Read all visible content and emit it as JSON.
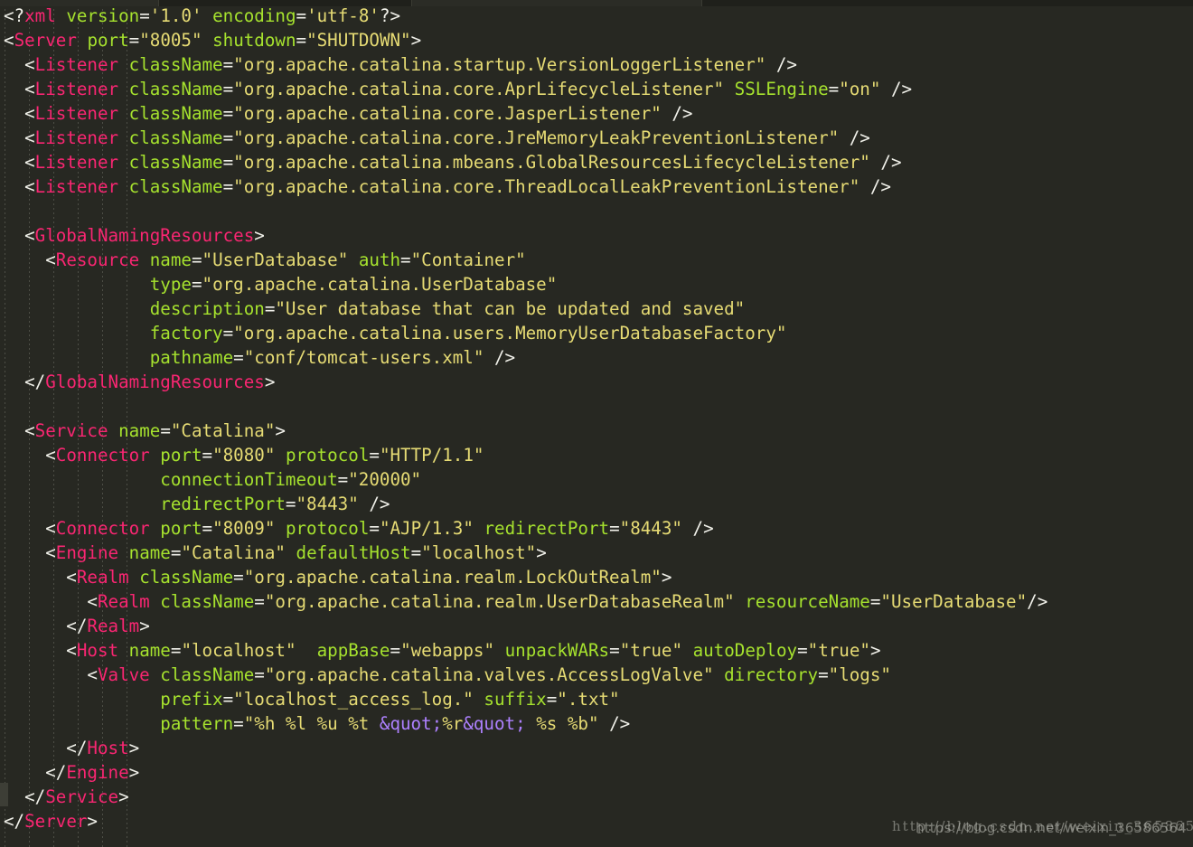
{
  "app": {
    "kind": "code-editor",
    "language": "xml",
    "theme": "monokai-dark",
    "file_description": "Apache Tomcat server.xml configuration"
  },
  "theme_colors": {
    "background": "#272822",
    "punctuation": "#f1f1ea",
    "tag_name": "#f92672",
    "attribute_name": "#a6e22e",
    "attribute_value": "#e6db74",
    "entity": "#ae81ff",
    "indent_guide": "#5a5b52",
    "top_strip": "#1f201b"
  },
  "watermarks": {
    "line1": "http://blog.csdn.net/weixin_36586564",
    "line2": "https://blog.csdn.net/weixin_36586564"
  },
  "code": {
    "lines": [
      [
        {
          "t": "punct",
          "s": "<?"
        },
        {
          "t": "tag",
          "s": "xml"
        },
        {
          "t": "punct",
          "s": " "
        },
        {
          "t": "attr",
          "s": "version"
        },
        {
          "t": "punct",
          "s": "="
        },
        {
          "t": "val",
          "s": "'1.0'"
        },
        {
          "t": "punct",
          "s": " "
        },
        {
          "t": "attr",
          "s": "encoding"
        },
        {
          "t": "punct",
          "s": "="
        },
        {
          "t": "val",
          "s": "'utf-8'"
        },
        {
          "t": "punct",
          "s": "?>"
        }
      ],
      [
        {
          "t": "punct",
          "s": "<"
        },
        {
          "t": "tag",
          "s": "Server"
        },
        {
          "t": "punct",
          "s": " "
        },
        {
          "t": "attr",
          "s": "port"
        },
        {
          "t": "punct",
          "s": "="
        },
        {
          "t": "val",
          "s": "\"8005\""
        },
        {
          "t": "punct",
          "s": " "
        },
        {
          "t": "attr",
          "s": "shutdown"
        },
        {
          "t": "punct",
          "s": "="
        },
        {
          "t": "val",
          "s": "\"SHUTDOWN\""
        },
        {
          "t": "punct",
          "s": ">"
        }
      ],
      [
        {
          "t": "punct",
          "s": "  <"
        },
        {
          "t": "tag",
          "s": "Listener"
        },
        {
          "t": "punct",
          "s": " "
        },
        {
          "t": "attr",
          "s": "className"
        },
        {
          "t": "punct",
          "s": "="
        },
        {
          "t": "val",
          "s": "\"org.apache.catalina.startup.VersionLoggerListener\""
        },
        {
          "t": "punct",
          "s": " />"
        }
      ],
      [
        {
          "t": "punct",
          "s": "  <"
        },
        {
          "t": "tag",
          "s": "Listener"
        },
        {
          "t": "punct",
          "s": " "
        },
        {
          "t": "attr",
          "s": "className"
        },
        {
          "t": "punct",
          "s": "="
        },
        {
          "t": "val",
          "s": "\"org.apache.catalina.core.AprLifecycleListener\""
        },
        {
          "t": "punct",
          "s": " "
        },
        {
          "t": "attr",
          "s": "SSLEngine"
        },
        {
          "t": "punct",
          "s": "="
        },
        {
          "t": "val",
          "s": "\"on\""
        },
        {
          "t": "punct",
          "s": " />"
        }
      ],
      [
        {
          "t": "punct",
          "s": "  <"
        },
        {
          "t": "tag",
          "s": "Listener"
        },
        {
          "t": "punct",
          "s": " "
        },
        {
          "t": "attr",
          "s": "className"
        },
        {
          "t": "punct",
          "s": "="
        },
        {
          "t": "val",
          "s": "\"org.apache.catalina.core.JasperListener\""
        },
        {
          "t": "punct",
          "s": " />"
        }
      ],
      [
        {
          "t": "punct",
          "s": "  <"
        },
        {
          "t": "tag",
          "s": "Listener"
        },
        {
          "t": "punct",
          "s": " "
        },
        {
          "t": "attr",
          "s": "className"
        },
        {
          "t": "punct",
          "s": "="
        },
        {
          "t": "val",
          "s": "\"org.apache.catalina.core.JreMemoryLeakPreventionListener\""
        },
        {
          "t": "punct",
          "s": " />"
        }
      ],
      [
        {
          "t": "punct",
          "s": "  <"
        },
        {
          "t": "tag",
          "s": "Listener"
        },
        {
          "t": "punct",
          "s": " "
        },
        {
          "t": "attr",
          "s": "className"
        },
        {
          "t": "punct",
          "s": "="
        },
        {
          "t": "val",
          "s": "\"org.apache.catalina.mbeans.GlobalResourcesLifecycleListener\""
        },
        {
          "t": "punct",
          "s": " />"
        }
      ],
      [
        {
          "t": "punct",
          "s": "  <"
        },
        {
          "t": "tag",
          "s": "Listener"
        },
        {
          "t": "punct",
          "s": " "
        },
        {
          "t": "attr",
          "s": "className"
        },
        {
          "t": "punct",
          "s": "="
        },
        {
          "t": "val",
          "s": "\"org.apache.catalina.core.ThreadLocalLeakPreventionListener\""
        },
        {
          "t": "punct",
          "s": " />"
        }
      ],
      [],
      [
        {
          "t": "punct",
          "s": "  <"
        },
        {
          "t": "tag",
          "s": "GlobalNamingResources"
        },
        {
          "t": "punct",
          "s": ">"
        }
      ],
      [
        {
          "t": "punct",
          "s": "    <"
        },
        {
          "t": "tag",
          "s": "Resource"
        },
        {
          "t": "punct",
          "s": " "
        },
        {
          "t": "attr",
          "s": "name"
        },
        {
          "t": "punct",
          "s": "="
        },
        {
          "t": "val",
          "s": "\"UserDatabase\""
        },
        {
          "t": "punct",
          "s": " "
        },
        {
          "t": "attr",
          "s": "auth"
        },
        {
          "t": "punct",
          "s": "="
        },
        {
          "t": "val",
          "s": "\"Container\""
        }
      ],
      [
        {
          "t": "punct",
          "s": "              "
        },
        {
          "t": "attr",
          "s": "type"
        },
        {
          "t": "punct",
          "s": "="
        },
        {
          "t": "val",
          "s": "\"org.apache.catalina.UserDatabase\""
        }
      ],
      [
        {
          "t": "punct",
          "s": "              "
        },
        {
          "t": "attr",
          "s": "description"
        },
        {
          "t": "punct",
          "s": "="
        },
        {
          "t": "val",
          "s": "\"User database that can be updated and saved\""
        }
      ],
      [
        {
          "t": "punct",
          "s": "              "
        },
        {
          "t": "attr",
          "s": "factory"
        },
        {
          "t": "punct",
          "s": "="
        },
        {
          "t": "val",
          "s": "\"org.apache.catalina.users.MemoryUserDatabaseFactory\""
        }
      ],
      [
        {
          "t": "punct",
          "s": "              "
        },
        {
          "t": "attr",
          "s": "pathname"
        },
        {
          "t": "punct",
          "s": "="
        },
        {
          "t": "val",
          "s": "\"conf/tomcat-users.xml\""
        },
        {
          "t": "punct",
          "s": " />"
        }
      ],
      [
        {
          "t": "punct",
          "s": "  </"
        },
        {
          "t": "tag",
          "s": "GlobalNamingResources"
        },
        {
          "t": "punct",
          "s": ">"
        }
      ],
      [],
      [
        {
          "t": "punct",
          "s": "  <"
        },
        {
          "t": "tag",
          "s": "Service"
        },
        {
          "t": "punct",
          "s": " "
        },
        {
          "t": "attr",
          "s": "name"
        },
        {
          "t": "punct",
          "s": "="
        },
        {
          "t": "val",
          "s": "\"Catalina\""
        },
        {
          "t": "punct",
          "s": ">"
        }
      ],
      [
        {
          "t": "punct",
          "s": "    <"
        },
        {
          "t": "tag",
          "s": "Connector"
        },
        {
          "t": "punct",
          "s": " "
        },
        {
          "t": "attr",
          "s": "port"
        },
        {
          "t": "punct",
          "s": "="
        },
        {
          "t": "val",
          "s": "\"8080\""
        },
        {
          "t": "punct",
          "s": " "
        },
        {
          "t": "attr",
          "s": "protocol"
        },
        {
          "t": "punct",
          "s": "="
        },
        {
          "t": "val",
          "s": "\"HTTP/1.1\""
        }
      ],
      [
        {
          "t": "punct",
          "s": "               "
        },
        {
          "t": "attr",
          "s": "connectionTimeout"
        },
        {
          "t": "punct",
          "s": "="
        },
        {
          "t": "val",
          "s": "\"20000\""
        }
      ],
      [
        {
          "t": "punct",
          "s": "               "
        },
        {
          "t": "attr",
          "s": "redirectPort"
        },
        {
          "t": "punct",
          "s": "="
        },
        {
          "t": "val",
          "s": "\"8443\""
        },
        {
          "t": "punct",
          "s": " />"
        }
      ],
      [
        {
          "t": "punct",
          "s": "    <"
        },
        {
          "t": "tag",
          "s": "Connector"
        },
        {
          "t": "punct",
          "s": " "
        },
        {
          "t": "attr",
          "s": "port"
        },
        {
          "t": "punct",
          "s": "="
        },
        {
          "t": "val",
          "s": "\"8009\""
        },
        {
          "t": "punct",
          "s": " "
        },
        {
          "t": "attr",
          "s": "protocol"
        },
        {
          "t": "punct",
          "s": "="
        },
        {
          "t": "val",
          "s": "\"AJP/1.3\""
        },
        {
          "t": "punct",
          "s": " "
        },
        {
          "t": "attr",
          "s": "redirectPort"
        },
        {
          "t": "punct",
          "s": "="
        },
        {
          "t": "val",
          "s": "\"8443\""
        },
        {
          "t": "punct",
          "s": " />"
        }
      ],
      [
        {
          "t": "punct",
          "s": "    <"
        },
        {
          "t": "tag",
          "s": "Engine"
        },
        {
          "t": "punct",
          "s": " "
        },
        {
          "t": "attr",
          "s": "name"
        },
        {
          "t": "punct",
          "s": "="
        },
        {
          "t": "val",
          "s": "\"Catalina\""
        },
        {
          "t": "punct",
          "s": " "
        },
        {
          "t": "attr",
          "s": "defaultHost"
        },
        {
          "t": "punct",
          "s": "="
        },
        {
          "t": "val",
          "s": "\"localhost\""
        },
        {
          "t": "punct",
          "s": ">"
        }
      ],
      [
        {
          "t": "punct",
          "s": "      <"
        },
        {
          "t": "tag",
          "s": "Realm"
        },
        {
          "t": "punct",
          "s": " "
        },
        {
          "t": "attr",
          "s": "className"
        },
        {
          "t": "punct",
          "s": "="
        },
        {
          "t": "val",
          "s": "\"org.apache.catalina.realm.LockOutRealm\""
        },
        {
          "t": "punct",
          "s": ">"
        }
      ],
      [
        {
          "t": "punct",
          "s": "        <"
        },
        {
          "t": "tag",
          "s": "Realm"
        },
        {
          "t": "punct",
          "s": " "
        },
        {
          "t": "attr",
          "s": "className"
        },
        {
          "t": "punct",
          "s": "="
        },
        {
          "t": "val",
          "s": "\"org.apache.catalina.realm.UserDatabaseRealm\""
        },
        {
          "t": "punct",
          "s": " "
        },
        {
          "t": "attr",
          "s": "resourceName"
        },
        {
          "t": "punct",
          "s": "="
        },
        {
          "t": "val",
          "s": "\"UserDatabase\""
        },
        {
          "t": "punct",
          "s": "/>"
        }
      ],
      [
        {
          "t": "punct",
          "s": "      </"
        },
        {
          "t": "tag",
          "s": "Realm"
        },
        {
          "t": "punct",
          "s": ">"
        }
      ],
      [
        {
          "t": "punct",
          "s": "      <"
        },
        {
          "t": "tag",
          "s": "Host"
        },
        {
          "t": "punct",
          "s": " "
        },
        {
          "t": "attr",
          "s": "name"
        },
        {
          "t": "punct",
          "s": "="
        },
        {
          "t": "val",
          "s": "\"localhost\""
        },
        {
          "t": "punct",
          "s": "  "
        },
        {
          "t": "attr",
          "s": "appBase"
        },
        {
          "t": "punct",
          "s": "="
        },
        {
          "t": "val",
          "s": "\"webapps\""
        },
        {
          "t": "punct",
          "s": " "
        },
        {
          "t": "attr",
          "s": "unpackWARs"
        },
        {
          "t": "punct",
          "s": "="
        },
        {
          "t": "val",
          "s": "\"true\""
        },
        {
          "t": "punct",
          "s": " "
        },
        {
          "t": "attr",
          "s": "autoDeploy"
        },
        {
          "t": "punct",
          "s": "="
        },
        {
          "t": "val",
          "s": "\"true\""
        },
        {
          "t": "punct",
          "s": ">"
        }
      ],
      [
        {
          "t": "punct",
          "s": "        <"
        },
        {
          "t": "tag",
          "s": "Valve"
        },
        {
          "t": "punct",
          "s": " "
        },
        {
          "t": "attr",
          "s": "className"
        },
        {
          "t": "punct",
          "s": "="
        },
        {
          "t": "val",
          "s": "\"org.apache.catalina.valves.AccessLogValve\""
        },
        {
          "t": "punct",
          "s": " "
        },
        {
          "t": "attr",
          "s": "directory"
        },
        {
          "t": "punct",
          "s": "="
        },
        {
          "t": "val",
          "s": "\"logs\""
        }
      ],
      [
        {
          "t": "punct",
          "s": "               "
        },
        {
          "t": "attr",
          "s": "prefix"
        },
        {
          "t": "punct",
          "s": "="
        },
        {
          "t": "val",
          "s": "\"localhost_access_log.\""
        },
        {
          "t": "punct",
          "s": " "
        },
        {
          "t": "attr",
          "s": "suffix"
        },
        {
          "t": "punct",
          "s": "="
        },
        {
          "t": "val",
          "s": "\".txt\""
        }
      ],
      [
        {
          "t": "punct",
          "s": "               "
        },
        {
          "t": "attr",
          "s": "pattern"
        },
        {
          "t": "punct",
          "s": "="
        },
        {
          "t": "val",
          "s": "\"%h %l %u %t "
        },
        {
          "t": "ent",
          "s": "&quot;"
        },
        {
          "t": "val",
          "s": "%r"
        },
        {
          "t": "ent",
          "s": "&quot;"
        },
        {
          "t": "val",
          "s": " %s %b\""
        },
        {
          "t": "punct",
          "s": " />"
        }
      ],
      [
        {
          "t": "punct",
          "s": "      </"
        },
        {
          "t": "tag",
          "s": "Host"
        },
        {
          "t": "punct",
          "s": ">"
        }
      ],
      [
        {
          "t": "punct",
          "s": "    </"
        },
        {
          "t": "tag",
          "s": "Engine"
        },
        {
          "t": "punct",
          "s": ">"
        }
      ],
      [
        {
          "t": "punct",
          "s": "  </"
        },
        {
          "t": "tag",
          "s": "Service"
        },
        {
          "t": "punct",
          "s": ">"
        }
      ],
      [
        {
          "t": "punct",
          "s": "</"
        },
        {
          "t": "tag",
          "s": "Server"
        },
        {
          "t": "punct",
          "s": ">"
        }
      ]
    ],
    "indent_guide_x": [
      5,
      32,
      59,
      86,
      113,
      140
    ]
  }
}
